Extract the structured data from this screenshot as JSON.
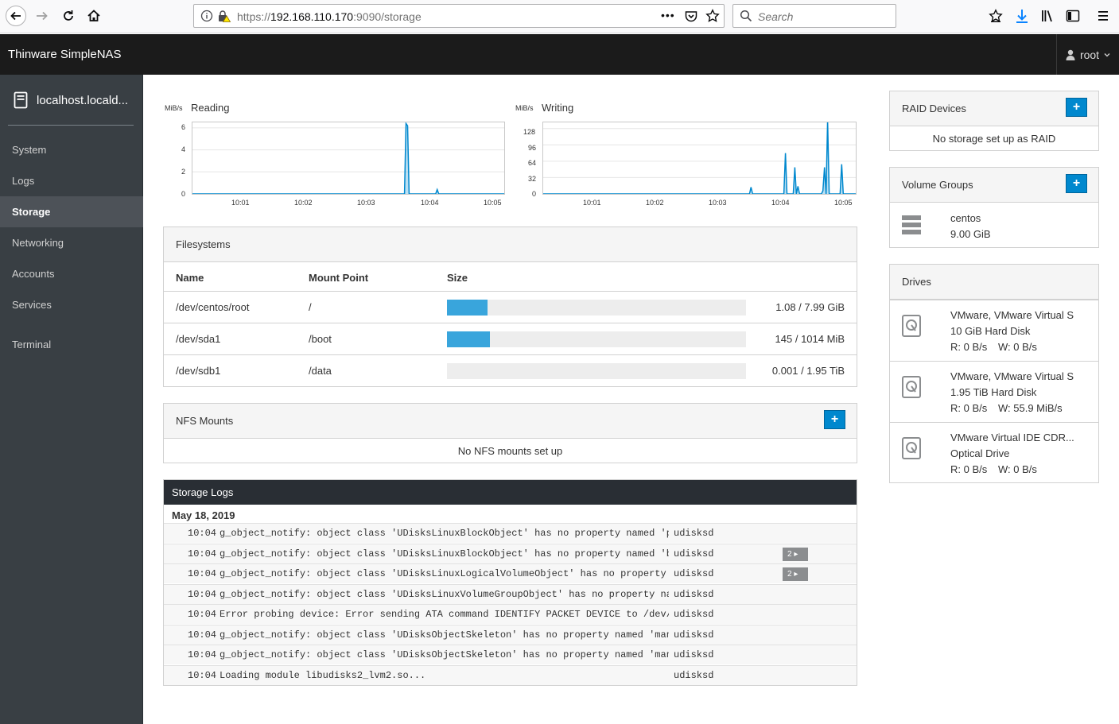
{
  "browser": {
    "url_prefix": "https://",
    "url_host": "192.168.110.170",
    "url_path": ":9090/storage",
    "search_placeholder": "Search",
    "page_actions": "•••"
  },
  "header": {
    "brand": "Thinware SimpleNAS",
    "user": "root"
  },
  "sidebar": {
    "host": "localhost.locald...",
    "items": [
      {
        "label": "System"
      },
      {
        "label": "Logs"
      },
      {
        "label": "Storage"
      },
      {
        "label": "Networking"
      },
      {
        "label": "Accounts"
      },
      {
        "label": "Services"
      },
      {
        "label": "Terminal"
      }
    ]
  },
  "chart_data": [
    {
      "type": "line",
      "title": "Reading",
      "ylabel": "MiB/s",
      "ylim": [
        0,
        6.5
      ],
      "yticks": [
        "6",
        "4",
        "2",
        "0"
      ],
      "xticks": [
        "10:01",
        "10:02",
        "10:03",
        "10:04",
        "10:05"
      ],
      "x": [
        0,
        0.68,
        0.685,
        0.69,
        0.695,
        0.78,
        0.785,
        0.79,
        1
      ],
      "series": [
        {
          "values": [
            0,
            0,
            6.4,
            6.2,
            0,
            0,
            0.4,
            0,
            0
          ]
        }
      ]
    },
    {
      "type": "line",
      "title": "Writing",
      "ylabel": "MiB/s",
      "ylim": [
        0,
        140
      ],
      "yticks": [
        "128",
        "96",
        "64",
        "32",
        "0"
      ],
      "xticks": [
        "10:01",
        "10:02",
        "10:03",
        "10:04",
        "10:05"
      ],
      "x": [
        0,
        0.66,
        0.665,
        0.67,
        0.77,
        0.775,
        0.78,
        0.8,
        0.805,
        0.81,
        0.815,
        0.82,
        0.89,
        0.895,
        0.9,
        0.905,
        0.91,
        0.915,
        0.92,
        0.95,
        0.955,
        0.96,
        1
      ],
      "series": [
        {
          "values": [
            0,
            0,
            13,
            0,
            0,
            80,
            0,
            0,
            52,
            0,
            15,
            0,
            0,
            6,
            52,
            0,
            145,
            0,
            0,
            0,
            58,
            0,
            0
          ]
        }
      ]
    }
  ],
  "filesystems": {
    "title": "Filesystems",
    "columns": [
      "Name",
      "Mount Point",
      "Size"
    ],
    "rows": [
      {
        "name": "/dev/centos/root",
        "mount": "/",
        "size": "1.08 / 7.99 GiB",
        "used_fraction": 0.135
      },
      {
        "name": "/dev/sda1",
        "mount": "/boot",
        "size": "145 / 1014 MiB",
        "used_fraction": 0.143
      },
      {
        "name": "/dev/sdb1",
        "mount": "/data",
        "size": "0.001 / 1.95 TiB",
        "used_fraction": 0.0005
      }
    ]
  },
  "nfs": {
    "title": "NFS Mounts",
    "add_label": "+",
    "empty": "No NFS mounts set up"
  },
  "logs": {
    "title": "Storage Logs",
    "date": "May 18, 2019",
    "entries": [
      {
        "time": "10:04",
        "message": "g_object_notify: object class 'UDisksLinuxBlockObject' has no property named 'p…",
        "source": "udisksd",
        "badge": ""
      },
      {
        "time": "10:04",
        "message": "g_object_notify: object class 'UDisksLinuxBlockObject' has no property named 'b…",
        "source": "udisksd",
        "badge": "2 ▸"
      },
      {
        "time": "10:04",
        "message": "g_object_notify: object class 'UDisksLinuxLogicalVolumeObject' has no property …",
        "source": "udisksd",
        "badge": "2 ▸"
      },
      {
        "time": "10:04",
        "message": "g_object_notify: object class 'UDisksLinuxVolumeGroupObject' has no property na…",
        "source": "udisksd",
        "badge": ""
      },
      {
        "time": "10:04",
        "message": "Error probing device: Error sending ATA command IDENTIFY PACKET DEVICE to /dev/…",
        "source": "udisksd",
        "badge": ""
      },
      {
        "time": "10:04",
        "message": "g_object_notify: object class 'UDisksObjectSkeleton' has no property named 'man…",
        "source": "udisksd",
        "badge": ""
      },
      {
        "time": "10:04",
        "message": "g_object_notify: object class 'UDisksObjectSkeleton' has no property named 'man…",
        "source": "udisksd",
        "badge": ""
      },
      {
        "time": "10:04",
        "message": "Loading module libudisks2_lvm2.so...",
        "source": "udisksd",
        "badge": ""
      }
    ]
  },
  "raid": {
    "title": "RAID Devices",
    "add_label": "+",
    "empty": "No storage set up as RAID"
  },
  "volume_groups": {
    "title": "Volume Groups",
    "add_label": "+",
    "items": [
      {
        "name": "centos",
        "size": "9.00 GiB"
      }
    ]
  },
  "drives": {
    "title": "Drives",
    "items": [
      {
        "name": "VMware, VMware Virtual S",
        "desc": "10 GiB Hard Disk",
        "read": "R: 0 B/s",
        "write": "W: 0 B/s"
      },
      {
        "name": "VMware, VMware Virtual S",
        "desc": "1.95 TiB Hard Disk",
        "read": "R: 0 B/s",
        "write": "W: 55.9 MiB/s"
      },
      {
        "name": "VMware Virtual IDE CDR...",
        "desc": "Optical Drive",
        "read": "R: 0 B/s",
        "write": "W: 0 B/s"
      }
    ]
  },
  "colors": {
    "accent": "#0088ce",
    "bar": "#39a5dc",
    "sidebar": "#393f44",
    "header": "#1b1b1b"
  }
}
